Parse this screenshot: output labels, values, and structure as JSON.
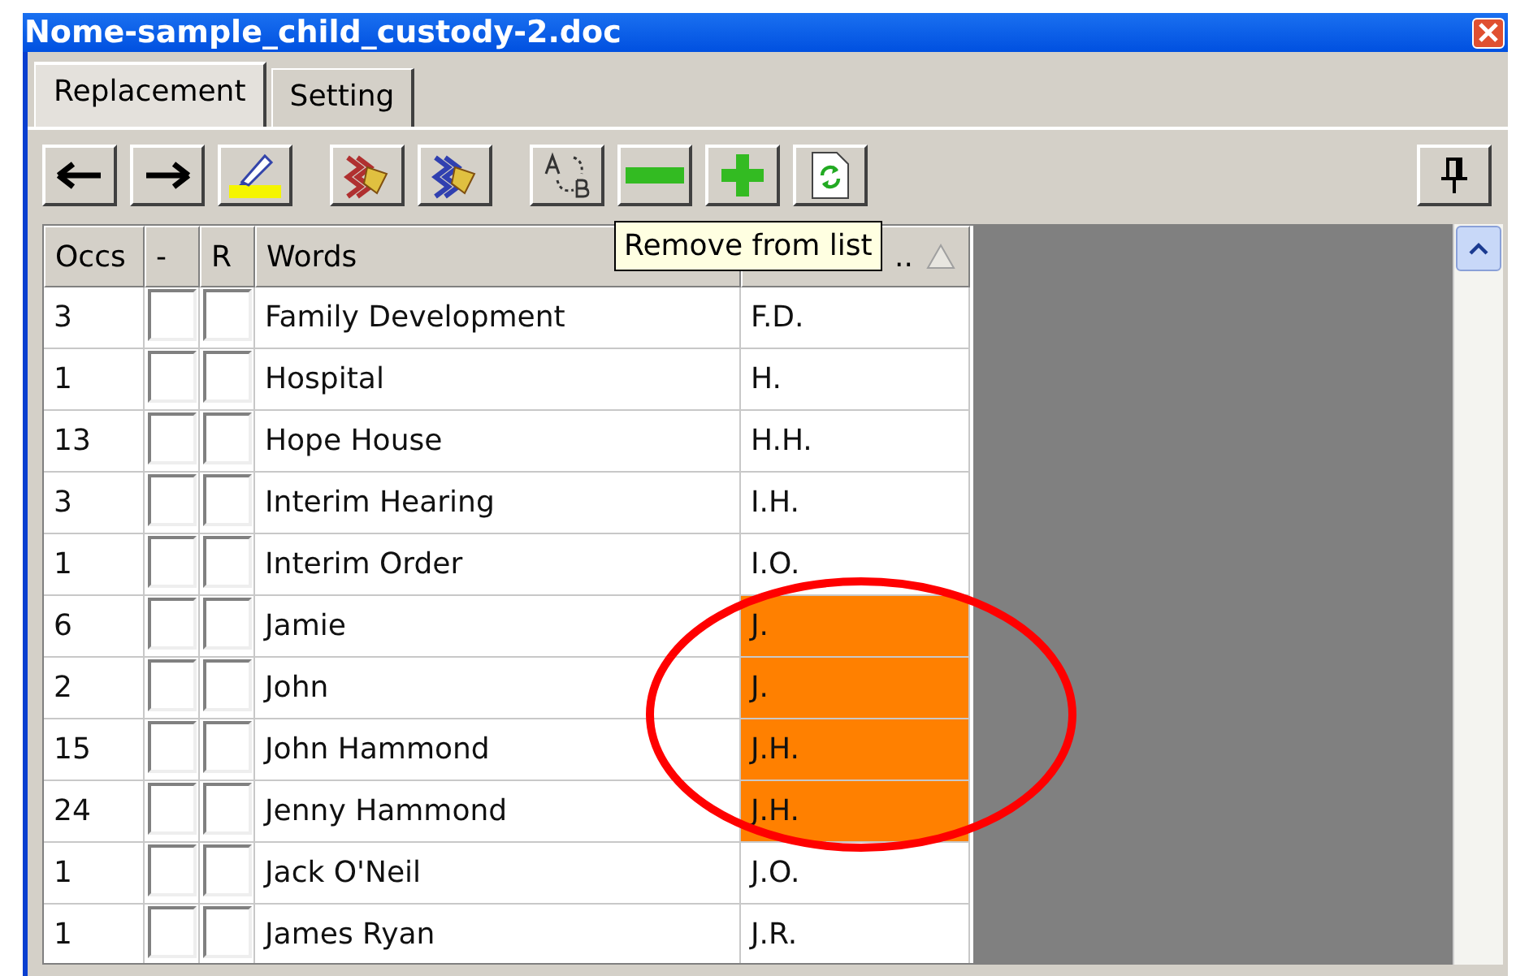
{
  "window": {
    "title": "Nome-sample_child_custody-2.doc"
  },
  "tabs": [
    {
      "label": "Replacement",
      "selected": true
    },
    {
      "label": "Setting",
      "selected": false
    }
  ],
  "toolbar": [
    {
      "kind": "left"
    },
    {
      "kind": "right"
    },
    {
      "kind": "highlight"
    },
    {
      "kind": "gap"
    },
    {
      "kind": "red-gear"
    },
    {
      "kind": "blue-gear"
    },
    {
      "kind": "gap"
    },
    {
      "kind": "ab"
    },
    {
      "kind": "minus"
    },
    {
      "kind": "plus"
    },
    {
      "kind": "refresh"
    }
  ],
  "tooltip": "Remove from list",
  "table": {
    "columns": [
      "Occs",
      "-",
      "R",
      "Words",
      ".."
    ],
    "rows": [
      {
        "occs": "3",
        "dash_checked": false,
        "r_checked": false,
        "word": "Family Development",
        "abbr": "F.D.",
        "highlighted": false
      },
      {
        "occs": "1",
        "dash_checked": false,
        "r_checked": false,
        "word": "Hospital",
        "abbr": "H.",
        "highlighted": false
      },
      {
        "occs": "13",
        "dash_checked": false,
        "r_checked": false,
        "word": "Hope House",
        "abbr": "H.H.",
        "highlighted": false
      },
      {
        "occs": "3",
        "dash_checked": false,
        "r_checked": false,
        "word": "Interim Hearing",
        "abbr": "I.H.",
        "highlighted": false
      },
      {
        "occs": "1",
        "dash_checked": false,
        "r_checked": false,
        "word": "Interim Order",
        "abbr": "I.O.",
        "highlighted": false
      },
      {
        "occs": "6",
        "dash_checked": false,
        "r_checked": false,
        "word": "Jamie",
        "abbr": "J.",
        "highlighted": true
      },
      {
        "occs": "2",
        "dash_checked": false,
        "r_checked": false,
        "word": "John",
        "abbr": "J.",
        "highlighted": true
      },
      {
        "occs": "15",
        "dash_checked": false,
        "r_checked": false,
        "word": "John Hammond",
        "abbr": "J.H.",
        "highlighted": true
      },
      {
        "occs": "24",
        "dash_checked": false,
        "r_checked": false,
        "word": "Jenny Hammond",
        "abbr": "J.H.",
        "highlighted": true
      },
      {
        "occs": "1",
        "dash_checked": false,
        "r_checked": false,
        "word": "Jack O'Neil",
        "abbr": "J.O.",
        "highlighted": false
      },
      {
        "occs": "1",
        "dash_checked": false,
        "r_checked": false,
        "word": "James Ryan",
        "abbr": "J.R.",
        "highlighted": false
      }
    ]
  }
}
